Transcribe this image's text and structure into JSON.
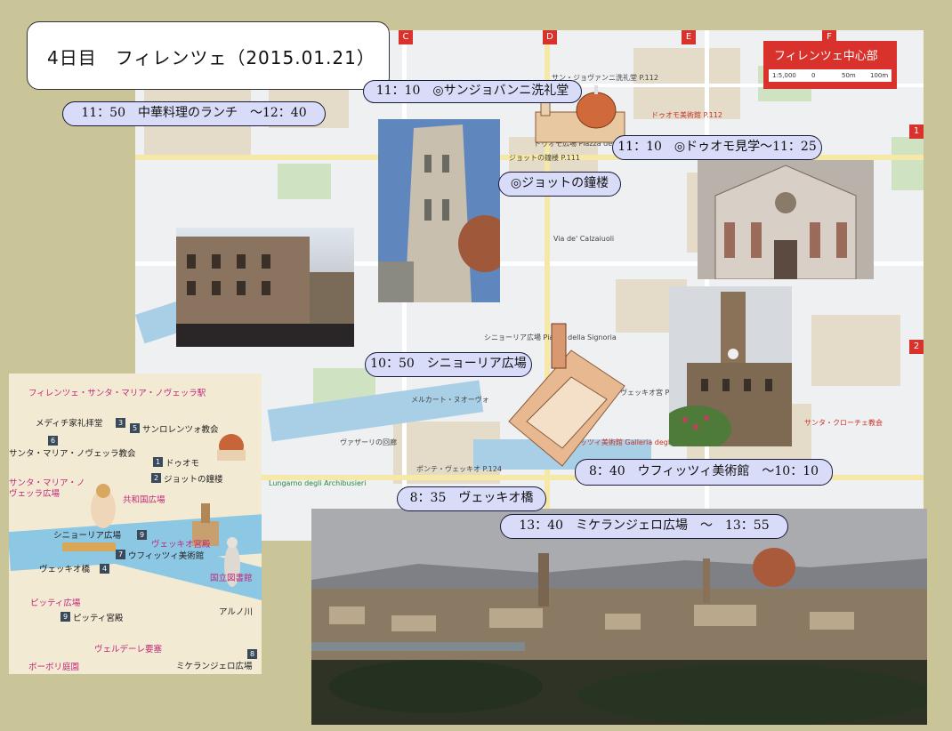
{
  "header": {
    "title": "4日目　フィレンツェ（2015.01.21）"
  },
  "main_map": {
    "title": "フィレンツェ中心部",
    "scale_text": "1:5,000",
    "scale_ticks": [
      "0",
      "50m",
      "100m"
    ],
    "grid_columns": [
      "C",
      "D",
      "E",
      "F"
    ],
    "grid_rows": [
      "1",
      "2"
    ],
    "labels": {
      "baptistery": "サン・ジョヴァンニ洗礼堂 P.112",
      "duomo_museum": "ドゥオモ美術館 P.112",
      "duomo_square": "ドゥオモ広場 Piazza del Duomo",
      "bell_tower": "ジョットの鐘楼 P.111",
      "signoria_square": "シニョーリア広場 Piazza della Signoria",
      "uffizi": "ウフィッツィ美術館 Galleria degli Uffizi",
      "palazzo_vecchio": "ヴェッキオ宮 P.124",
      "ponte_vecchio": "ポンテ・ヴェッキオ P.124",
      "vasari": "ヴァザーリの回廊",
      "santa_croce": "サンタ・クローチェ教会",
      "mercato": "メルカート・ヌオーヴォ",
      "via_calzaiuoli": "Via de' Calzaiuoli",
      "lungarno": "Lungarno degli Archibusieri"
    }
  },
  "schedule_labels": {
    "baptistery": "11：10　◎サンジョバンニ洗礼堂",
    "lunch": "11：50　中華料理のランチ　～12：40",
    "duomo": "11：10　◎ドゥオモ見学～11：25",
    "giotto": "◎ジョットの鐘楼",
    "signoria": "10：50　シニョーリア広場",
    "uffizi": "8：40　ウフィッツィ美術館　～10：10",
    "vecchio_bridge": "8：35　ヴェッキオ橋",
    "michelangelo": "13：40　ミケランジェロ広場　～　13：55"
  },
  "illustrated_map": {
    "items": [
      {
        "num": "",
        "text": "フィレンツェ・サンタ・マリア・ノヴェッラ駅"
      },
      {
        "num": "3",
        "text": "メディチ家礼拝堂"
      },
      {
        "num": "5",
        "text": "サンロレンツォ教会"
      },
      {
        "num": "6",
        "text": "サンタ・マリア・ノヴェッラ教会"
      },
      {
        "num": "1",
        "text": "ドゥオモ"
      },
      {
        "num": "2",
        "text": "ジョットの鐘楼"
      },
      {
        "num": "",
        "text": "サンタ・マリア・ノヴェッラ広場"
      },
      {
        "num": "",
        "text": "共和国広場"
      },
      {
        "num": "9",
        "text": "シニョーリア広場"
      },
      {
        "num": "",
        "text": "ヴェッキオ宮殿"
      },
      {
        "num": "7",
        "text": "ウフィッツィ美術館"
      },
      {
        "num": "4",
        "text": "ヴェッキオ橋"
      },
      {
        "num": "",
        "text": "国立図書館"
      },
      {
        "num": "",
        "text": "アルノ川"
      },
      {
        "num": "",
        "text": "ピッティ広場"
      },
      {
        "num": "9",
        "text": "ピッティ宮殿"
      },
      {
        "num": "",
        "text": "ヴェルデーレ要塞"
      },
      {
        "num": "",
        "text": "ボーボリ庭園"
      },
      {
        "num": "8",
        "text": "ミケランジェロ広場"
      }
    ]
  },
  "colors": {
    "label_bg": "#d8dcf8",
    "map_red": "#d9312b",
    "background": "#c9c598"
  }
}
